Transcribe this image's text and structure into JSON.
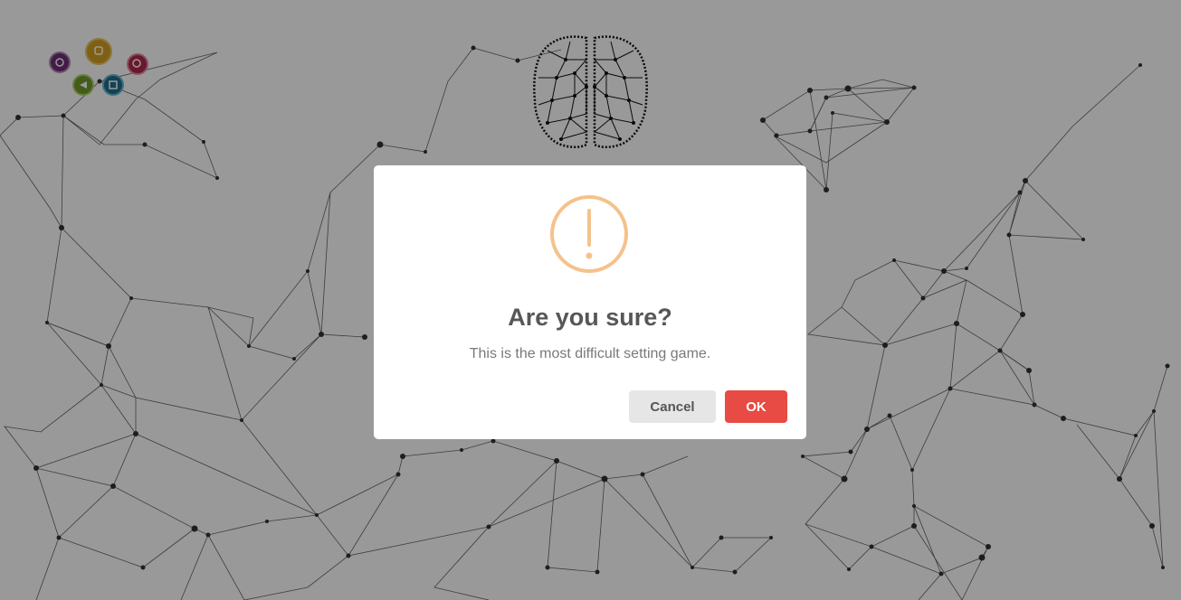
{
  "dialog": {
    "title": "Are you sure?",
    "text": "This is the most difficult setting game.",
    "cancel_label": "Cancel",
    "ok_label": "OK",
    "icon": "warning-exclamation-icon"
  },
  "colors": {
    "overlay": "rgba(0,0,0,0.4)",
    "warning": "#f5c28c",
    "ok_button": "#e84a44",
    "cancel_button": "#e6e6e6",
    "title": "#575757",
    "text": "#797979"
  },
  "logo": {
    "icons": [
      "purple-circle-icon",
      "orange-circle-icon",
      "red-circle-icon",
      "green-circle-icon",
      "blue-circle-icon"
    ]
  }
}
